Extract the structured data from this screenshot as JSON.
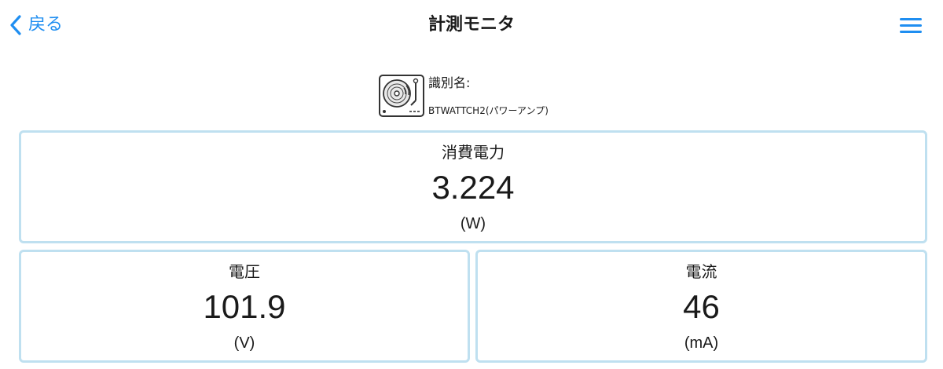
{
  "nav": {
    "back_label": "戻る",
    "title": "計測モニタ",
    "accent_color": "#1f8ef1",
    "back_icon": "chevron-left-icon",
    "menu_icon": "hamburger-menu-icon"
  },
  "device": {
    "icon": "turntable-icon",
    "label": "識別名:",
    "name": "BTWATTCH2(パワーアンプ)"
  },
  "metrics": {
    "power": {
      "label": "消費電力",
      "value": "3.224",
      "unit": "(W)"
    },
    "voltage": {
      "label": "電圧",
      "value": "101.9",
      "unit": "(V)"
    },
    "current": {
      "label": "電流",
      "value": "46",
      "unit": "(mA)"
    }
  },
  "colors": {
    "card_border": "#bfe0f0",
    "text": "#1a1a1a"
  }
}
